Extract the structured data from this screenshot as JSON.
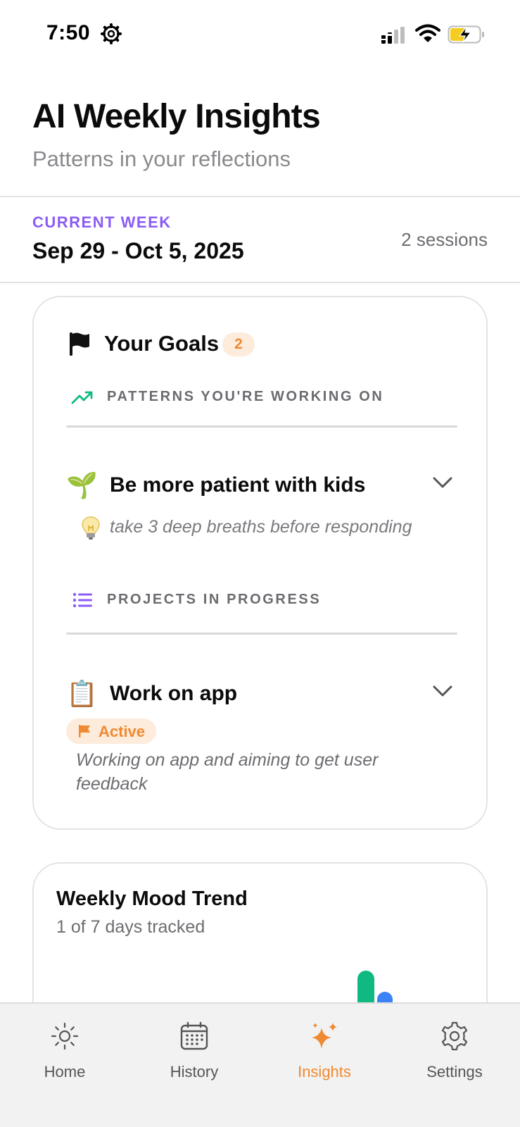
{
  "status_bar": {
    "time": "7:50"
  },
  "header": {
    "title": "AI Weekly Insights",
    "subtitle": "Patterns in your reflections"
  },
  "week": {
    "label": "CURRENT WEEK",
    "range": "Sep 29 - Oct 5, 2025",
    "sessions": "2 sessions"
  },
  "goals": {
    "title": "Your Goals",
    "count": "2",
    "patterns_section": {
      "label": "PATTERNS YOU'RE WORKING ON",
      "items": [
        {
          "emoji": "🌱",
          "title": "Be more patient with kids",
          "tip_icon": "lightbulb-icon",
          "tip": "take 3 deep breaths before responding"
        }
      ]
    },
    "projects_section": {
      "label": "PROJECTS IN PROGRESS",
      "items": [
        {
          "emoji": "📋",
          "title": "Work on app",
          "status": "Active",
          "description": "Working on app and aiming to get user feedback"
        }
      ]
    }
  },
  "mood": {
    "title": "Weekly Mood Trend",
    "subtitle": "1 of 7 days tracked"
  },
  "tabs": [
    {
      "label": "Home",
      "icon": "sun-icon",
      "active": false
    },
    {
      "label": "History",
      "icon": "calendar-icon",
      "active": false
    },
    {
      "label": "Insights",
      "icon": "sparkles-icon",
      "active": true
    },
    {
      "label": "Settings",
      "icon": "gear-icon",
      "active": false
    }
  ],
  "colors": {
    "accent": "#f08a32",
    "purple": "#8b5cf6",
    "green": "#10b981",
    "blue": "#3b82f6"
  }
}
